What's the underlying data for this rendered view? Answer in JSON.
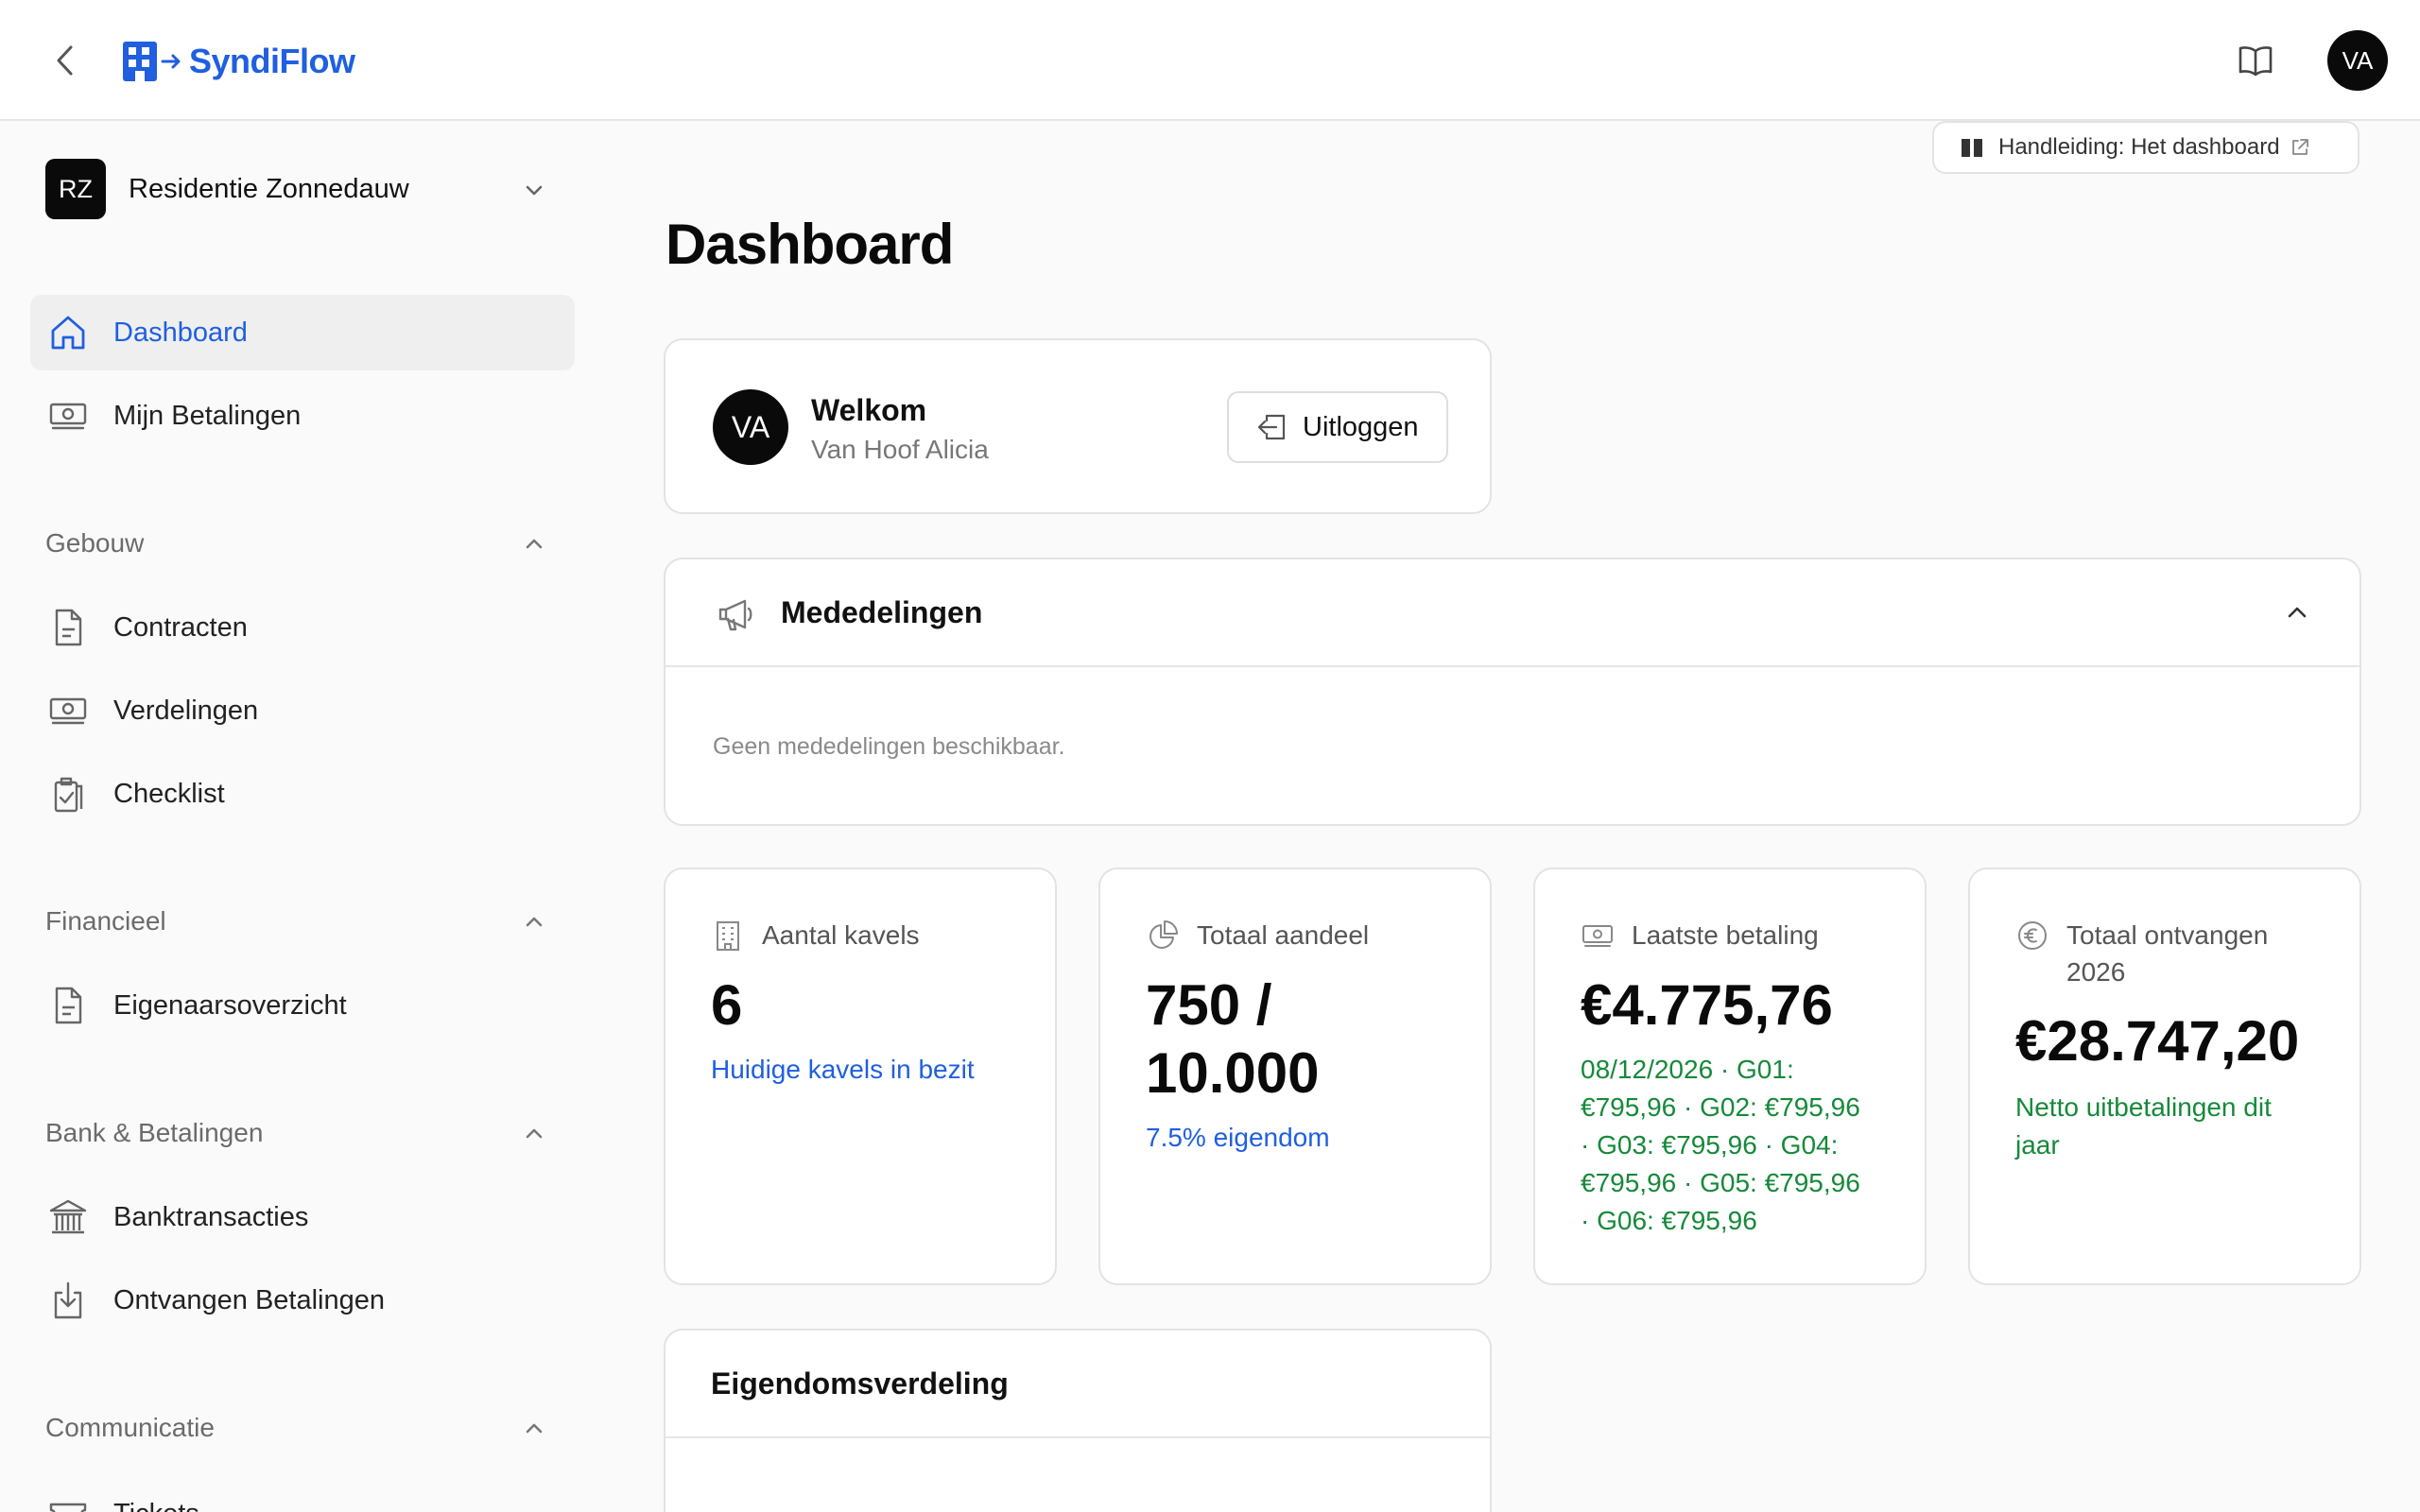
{
  "header": {
    "logo_text": "SyndiFlow",
    "user_initials": "VA",
    "brand_color": "#1f5fe0"
  },
  "sidebar": {
    "org_initials": "RZ",
    "org_name": "Residentie Zonnedauw",
    "items": [
      {
        "label": "Dashboard",
        "icon": "home-icon",
        "active": true
      },
      {
        "label": "Mijn Betalingen",
        "icon": "money-icon"
      }
    ],
    "sections": [
      {
        "label": "Gebouw",
        "items": [
          {
            "label": "Contracten",
            "icon": "document-icon"
          },
          {
            "label": "Verdelingen",
            "icon": "money-icon"
          },
          {
            "label": "Checklist",
            "icon": "clipboard-check-icon"
          }
        ]
      },
      {
        "label": "Financieel",
        "items": [
          {
            "label": "Eigenaarsoverzicht",
            "icon": "document-icon"
          }
        ]
      },
      {
        "label": "Bank & Betalingen",
        "items": [
          {
            "label": "Banktransacties",
            "icon": "bank-icon"
          },
          {
            "label": "Ontvangen Betalingen",
            "icon": "download-icon"
          }
        ]
      },
      {
        "label": "Communicatie",
        "items": [
          {
            "label": "Tickets",
            "icon": "ticket-icon"
          }
        ]
      }
    ]
  },
  "main": {
    "manual_link": "Handleiding: Het dashboard",
    "title": "Dashboard",
    "welcome": {
      "avatar": "VA",
      "title": "Welkom",
      "name": "Van Hoof Alicia",
      "logout_label": "Uitloggen"
    },
    "announcements": {
      "title": "Mededelingen",
      "empty_text": "Geen mededelingen beschikbaar."
    },
    "stats": [
      {
        "label": "Aantal kavels",
        "value": "6",
        "sub": "Huidige kavels in bezit",
        "icon": "building-icon"
      },
      {
        "label": "Totaal aandeel",
        "value_line1": "750 /",
        "value_line2": "10.000",
        "sub": "7.5% eigendom",
        "icon": "pie-chart-icon"
      },
      {
        "label": "Laatste betaling",
        "value": "€4.775,76",
        "sub_lines": [
          "08/12/2026 · G01:",
          "€795,96 · G02: €795,96",
          "· G03: €795,96 · G04:",
          "€795,96 · G05: €795,96",
          "· G06: €795,96"
        ],
        "icon": "money-icon"
      },
      {
        "label_line1": "Totaal ontvangen",
        "label_line2": "2026",
        "value": "€28.747,20",
        "sub_lines": [
          "Netto uitbetalingen dit",
          "jaar"
        ],
        "icon": "euro-icon"
      }
    ],
    "ownership": {
      "title": "Eigendomsverdeling"
    }
  }
}
